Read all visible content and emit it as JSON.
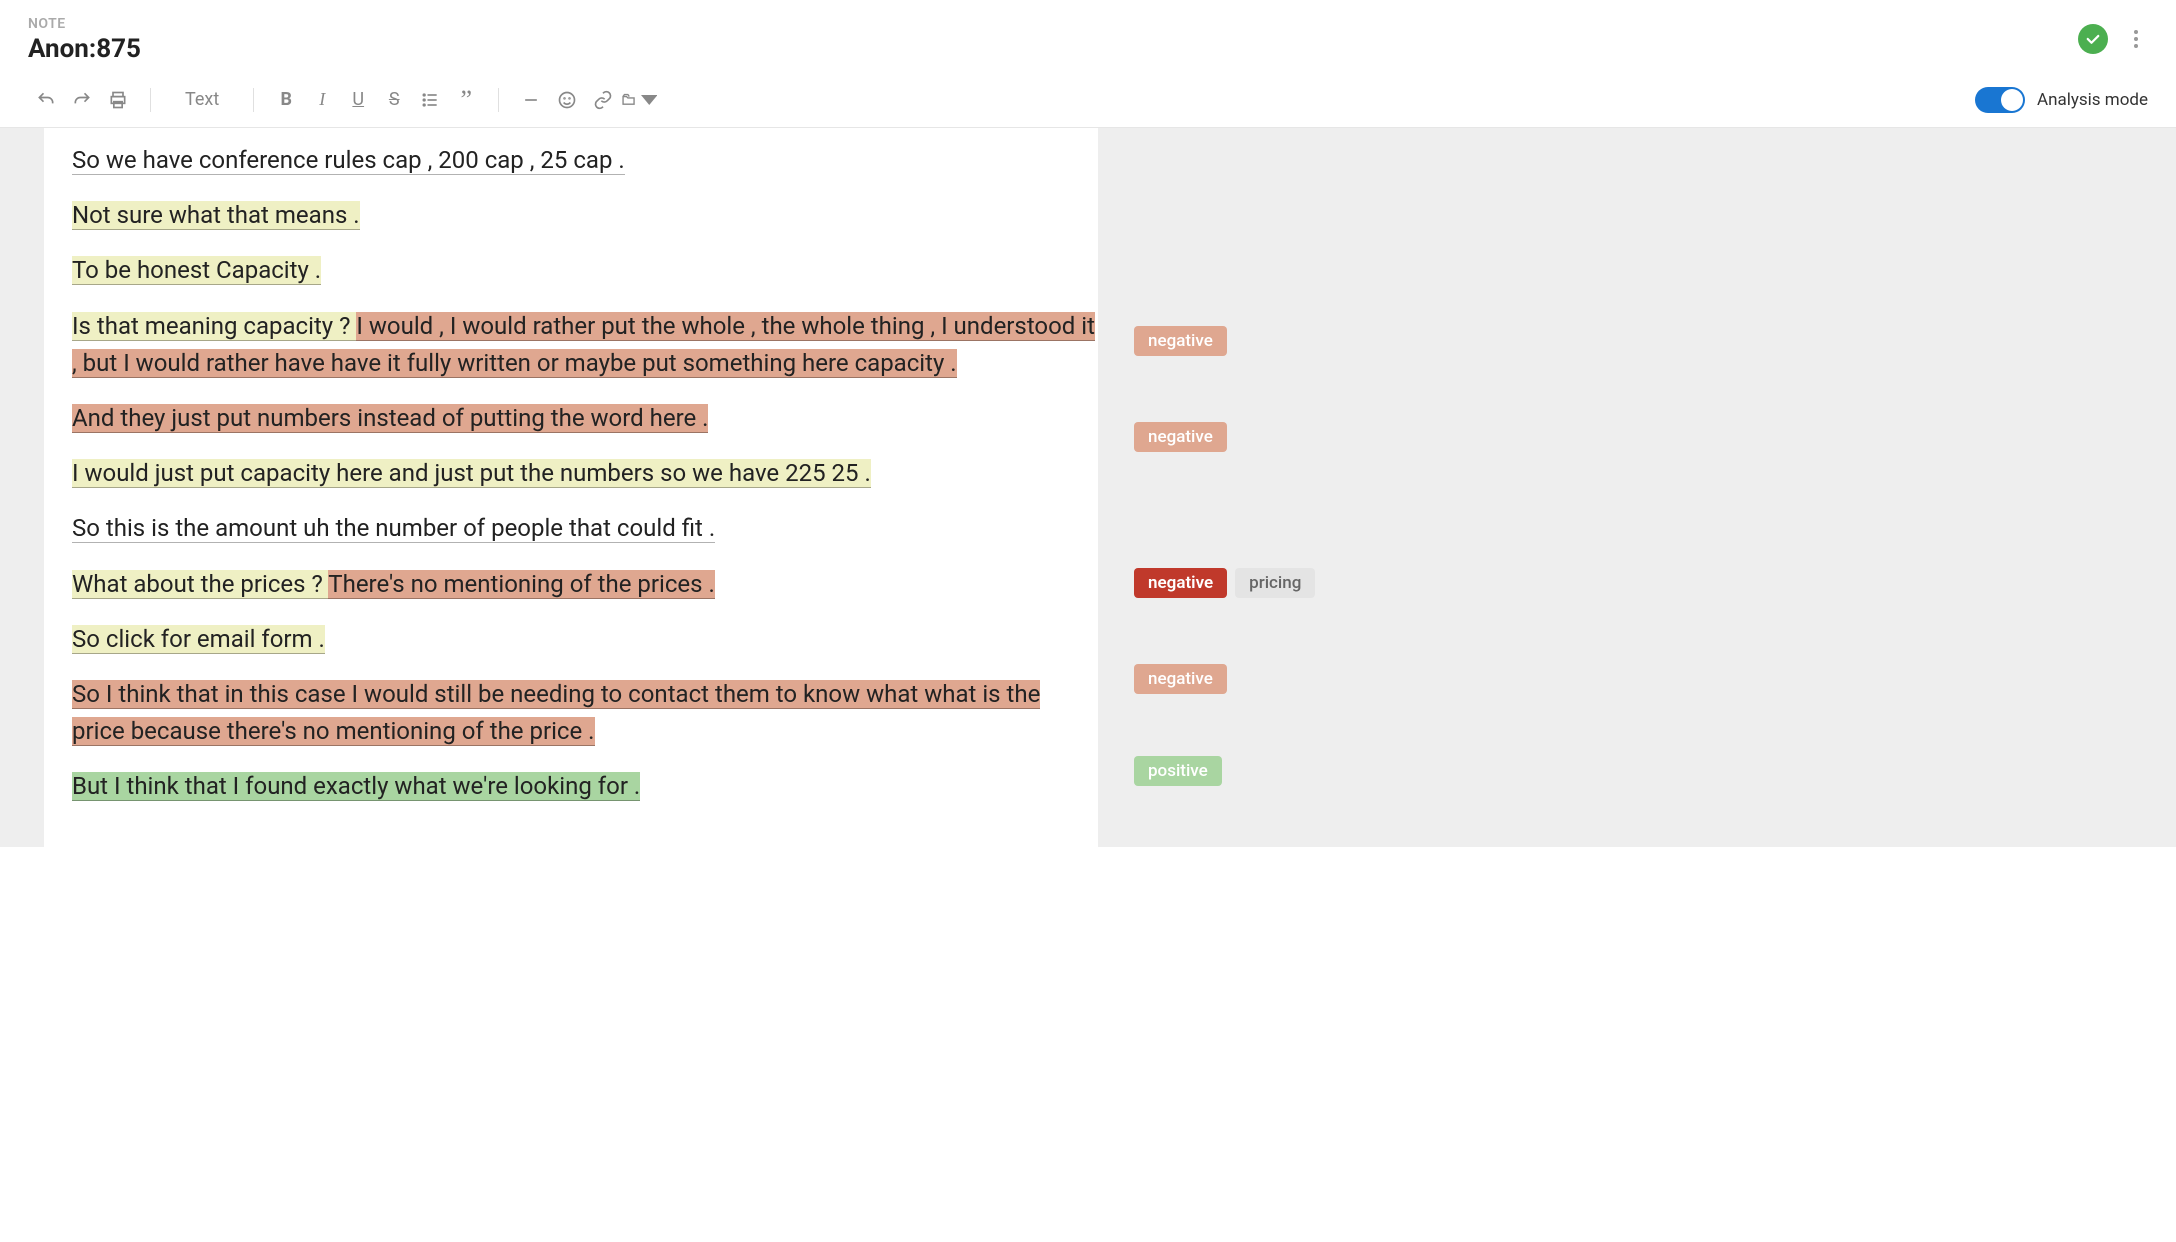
{
  "header": {
    "eyebrow": "NOTE",
    "title": "Anon:875"
  },
  "toolbar": {
    "text_placeholder": "Text",
    "toggle_label": "Analysis mode"
  },
  "lines": [
    {
      "segments": [
        {
          "text": "So we have conference rules cap , 200 cap , 25 cap .",
          "hl": "none"
        }
      ],
      "tags": []
    },
    {
      "segments": [
        {
          "text": "Not sure what that means .",
          "hl": "yellow"
        }
      ],
      "tags": []
    },
    {
      "segments": [
        {
          "text": "To be honest Capacity .",
          "hl": "yellow"
        }
      ],
      "tags": []
    },
    {
      "segments": [
        {
          "text": "Is that meaning capacity ? ",
          "hl": "yellow"
        },
        {
          "text": "I would , I would rather put the whole , the whole thing , I understood it , but I would rather have have it fully written or maybe put something here capacity .",
          "hl": "red-light"
        }
      ],
      "tags": [
        {
          "label": "negative",
          "style": "neg-light"
        }
      ]
    },
    {
      "segments": [
        {
          "text": "And they just put numbers instead of putting the word here .",
          "hl": "red-light"
        }
      ],
      "tags": [
        {
          "label": "negative",
          "style": "neg-light"
        }
      ]
    },
    {
      "segments": [
        {
          "text": "I would just put capacity here and just put the numbers so we have 225 25 .",
          "hl": "yellow"
        }
      ],
      "tags": []
    },
    {
      "segments": [
        {
          "text": "So this is the amount uh the number of people that could fit .",
          "hl": "none"
        }
      ],
      "tags": []
    },
    {
      "segments": [
        {
          "text": "What about the prices ? ",
          "hl": "yellow"
        },
        {
          "text": "There's no mentioning of the prices .",
          "hl": "red-light"
        }
      ],
      "tags": [
        {
          "label": "negative",
          "style": "neg-strong"
        },
        {
          "label": "pricing",
          "style": "grey"
        }
      ]
    },
    {
      "segments": [
        {
          "text": "So click for email form .",
          "hl": "yellow"
        }
      ],
      "tags": []
    },
    {
      "segments": [
        {
          "text": "So I think that in this case I would still be needing to contact them to know what what is the price because there's no mentioning of the price .",
          "hl": "red-light"
        }
      ],
      "tags": [
        {
          "label": "negative",
          "style": "neg-light"
        }
      ]
    },
    {
      "segments": [
        {
          "text": "But I think that I found exactly what we're looking for .",
          "hl": "green"
        }
      ],
      "tags": [
        {
          "label": "positive",
          "style": "pos"
        }
      ]
    }
  ]
}
